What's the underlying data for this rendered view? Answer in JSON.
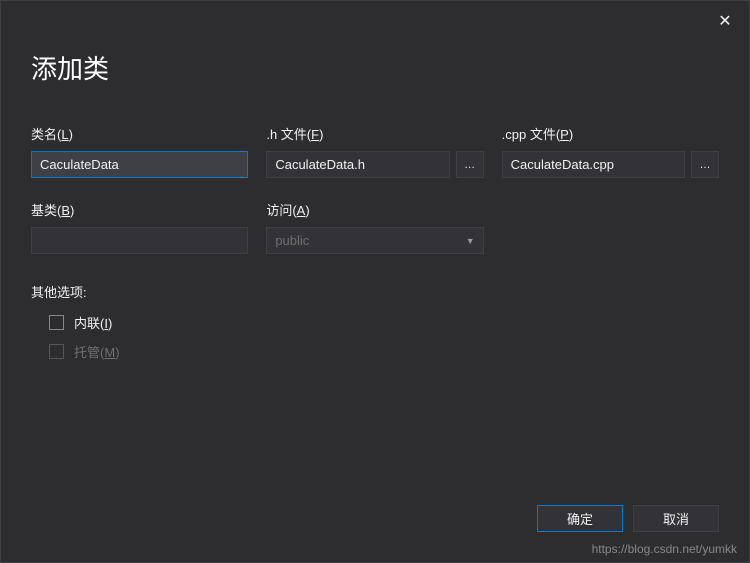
{
  "title": "添加类",
  "fields": {
    "className": {
      "label_pre": "类名(",
      "label_key": "L",
      "label_post": ")",
      "value": "CaculateData"
    },
    "hFile": {
      "label_pre": ".h 文件(",
      "label_key": "F",
      "label_post": ")",
      "value": "CaculateData.h",
      "browse": "…"
    },
    "cppFile": {
      "label_pre": ".cpp 文件(",
      "label_key": "P",
      "label_post": ")",
      "value": "CaculateData.cpp",
      "browse": "…"
    },
    "baseClass": {
      "label_pre": "基类(",
      "label_key": "B",
      "label_post": ")",
      "value": ""
    },
    "access": {
      "label_pre": "访问(",
      "label_key": "A",
      "label_post": ")",
      "value": "public"
    }
  },
  "options": {
    "title": "其他选项:",
    "inline": {
      "label_pre": "内联(",
      "label_key": "I",
      "label_post": ")"
    },
    "managed": {
      "label_pre": "托管(",
      "label_key": "M",
      "label_post": ")"
    }
  },
  "buttons": {
    "ok": "确定",
    "cancel": "取消"
  },
  "watermark": "https://blog.csdn.net/yumkk"
}
